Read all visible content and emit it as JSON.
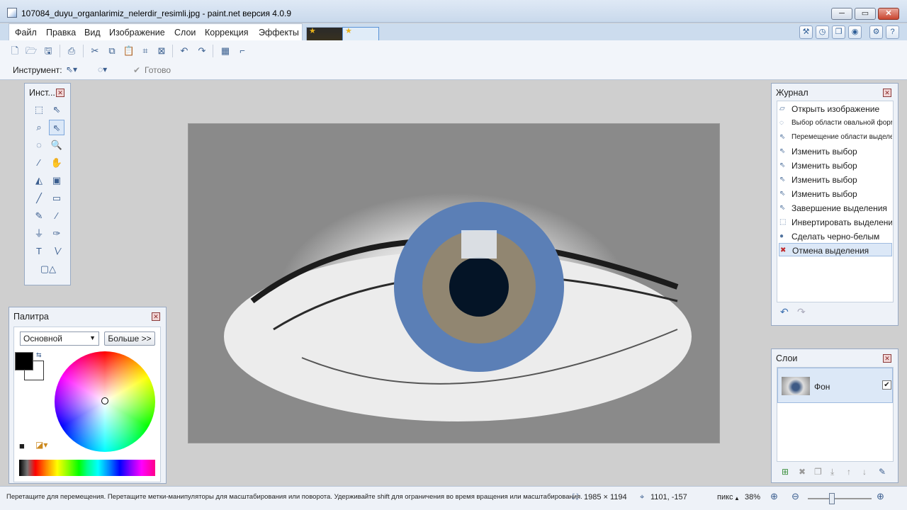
{
  "window": {
    "title": "107084_duyu_organlarimiz_nelerdir_resimli.jpg - paint.net версия 4.0.9",
    "min": "─",
    "max": "▭",
    "close": "✕"
  },
  "menu": [
    "Файл",
    "Правка",
    "Вид",
    "Изображение",
    "Слои",
    "Коррекция",
    "Эффекты"
  ],
  "toolbar": {
    "tool_label": "Инструмент:",
    "done_label": "Готово",
    "icons": [
      "new-icon",
      "open-icon",
      "save-icon",
      "print-icon",
      "cut-icon",
      "copy-icon",
      "paste-icon",
      "crop-icon",
      "deselect-icon",
      "undo-icon",
      "redo-icon",
      "grid-icon",
      "ruler-icon"
    ]
  },
  "tools_panel": {
    "title": "Инст...",
    "close": "✕"
  },
  "journal": {
    "title": "Журнал",
    "close": "✕",
    "items": [
      {
        "label": "Открыть изображение",
        "icon": "folder-icon"
      },
      {
        "label": "Выбор области овальной формы",
        "icon": "ellipse-select-icon"
      },
      {
        "label": "Перемещение области выделения",
        "icon": "move-selection-icon"
      },
      {
        "label": "Изменить выбор",
        "icon": "move-selection-icon"
      },
      {
        "label": "Изменить выбор",
        "icon": "move-selection-icon"
      },
      {
        "label": "Изменить выбор",
        "icon": "move-selection-icon"
      },
      {
        "label": "Изменить выбор",
        "icon": "move-selection-icon"
      },
      {
        "label": "Завершение выделения",
        "icon": "move-selection-icon"
      },
      {
        "label": "Инвертировать выделение",
        "icon": "invert-selection-icon"
      },
      {
        "label": "Сделать черно-белым",
        "icon": "black-white-icon"
      },
      {
        "label": "Отмена выделения",
        "icon": "deselect-icon"
      }
    ]
  },
  "layers": {
    "title": "Слои",
    "close": "✕",
    "items": [
      {
        "name": "Фон",
        "visible": true
      }
    ]
  },
  "palette": {
    "title": "Палитра",
    "close": "✕",
    "mode": "Основной",
    "more": "Больше >>",
    "primary": "#000000",
    "secondary": "#ffffff"
  },
  "status": {
    "hint": "Перетащите для перемещения. Перетащите метки-манипуляторы для масштабирования или поворота. Удерживайте shift для ограничения во время вращения или масштабирования.",
    "size": "1985 × 1194",
    "pos": "1101, -157",
    "units": "пикс",
    "zoom": "38%"
  }
}
